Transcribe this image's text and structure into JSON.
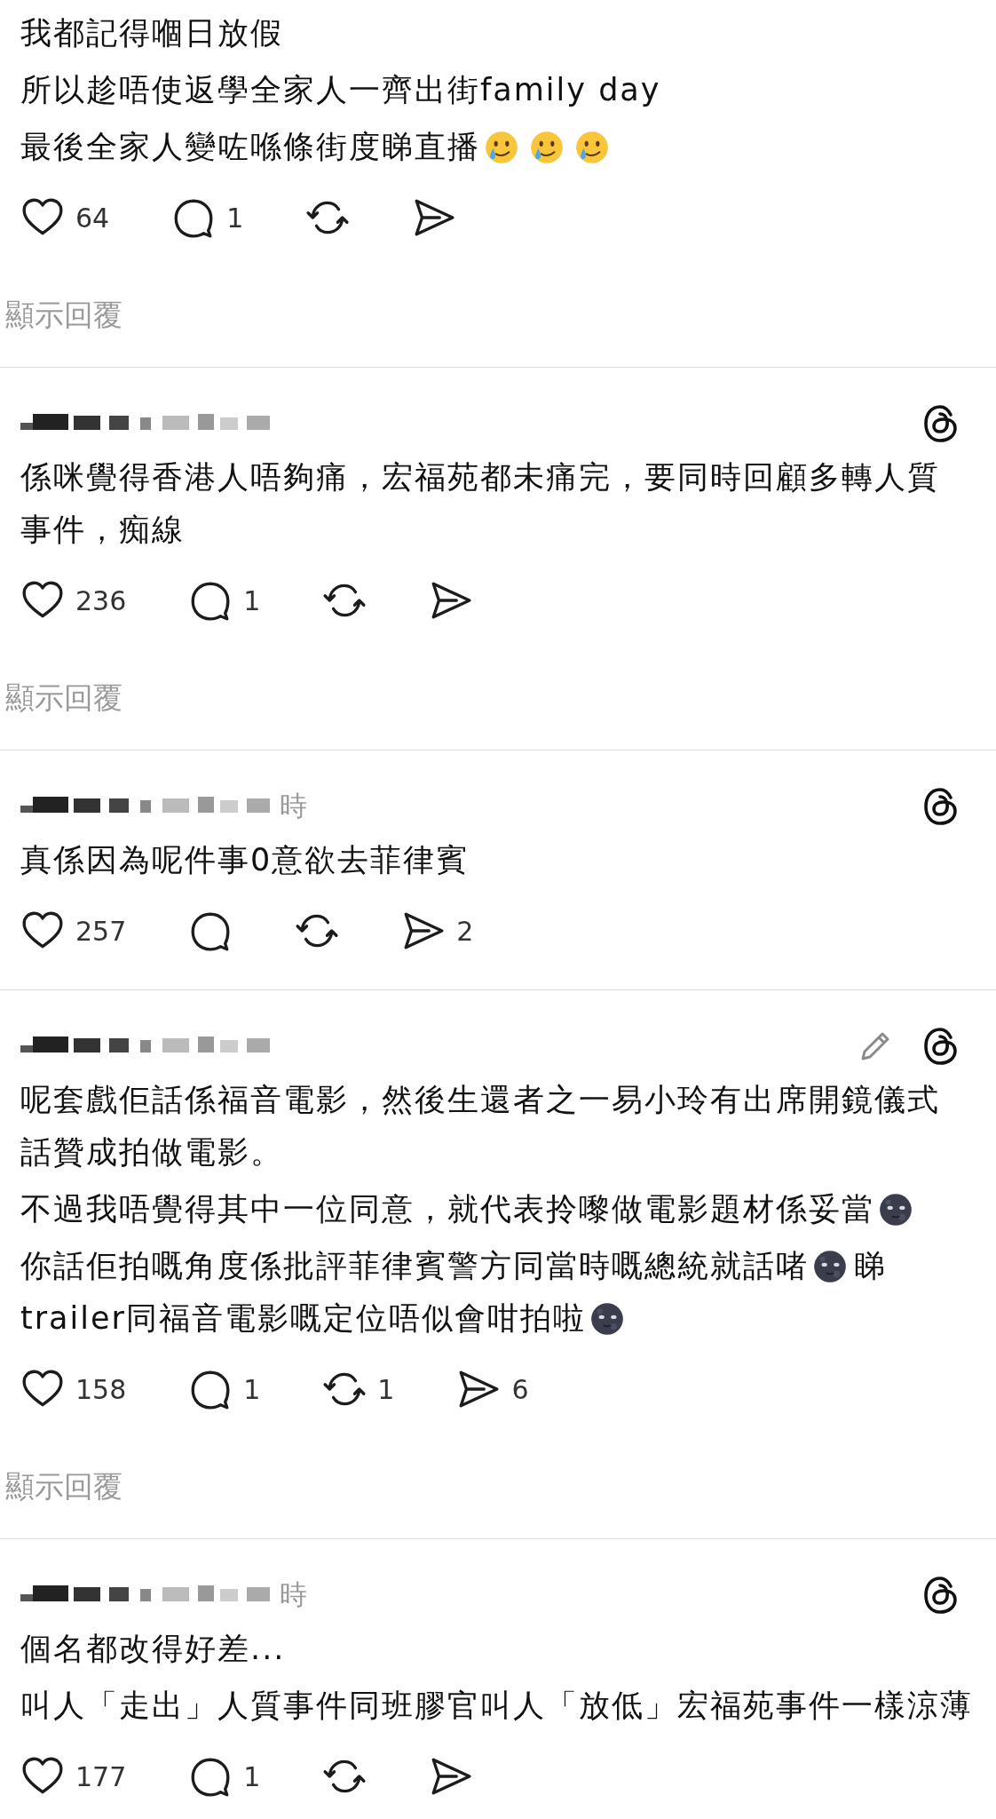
{
  "posts": [
    {
      "paragraphs": [
        [
          [
            {
              "kind": "text",
              "text": "我都記得嗰日放假"
            }
          ]
        ],
        [
          [
            {
              "kind": "text",
              "text": "所以趁唔使返學全家人一齊出街family day"
            }
          ]
        ],
        [
          [
            {
              "kind": "text",
              "text": "最後全家人變咗喺條街度睇直播"
            },
            {
              "kind": "teary-smile"
            },
            {
              "kind": "teary-smile"
            },
            {
              "kind": "teary-smile"
            }
          ]
        ]
      ],
      "actions": {
        "likes": "64",
        "comments": "1"
      },
      "show_replies": "顯示回覆"
    },
    {
      "author": {
        "pixelated": true
      },
      "threads_logo": true,
      "paragraphs": [
        [
          [
            {
              "kind": "text",
              "text": "係咪覺得香港人唔夠痛，宏福苑都未痛完，要同時回顧多轉人質"
            }
          ],
          [
            {
              "kind": "text",
              "text": "事件，痴線"
            }
          ]
        ]
      ],
      "actions": {
        "likes": "236",
        "comments": "1"
      },
      "show_replies": "顯示回覆"
    },
    {
      "author": {
        "pixelated": true,
        "time": "時"
      },
      "threads_logo": true,
      "paragraphs": [
        [
          [
            {
              "kind": "text",
              "text": "真係因為呢件事0意欲去菲律賓"
            }
          ]
        ]
      ],
      "actions": {
        "likes": "257",
        "shares": "2"
      }
    },
    {
      "author": {
        "pixelated": true
      },
      "edit_icon": true,
      "threads_logo": true,
      "paragraphs": [
        [
          [
            {
              "kind": "text",
              "text": "呢套戲佢話係福音電影，然後生還者之一易小玲有出席開鏡儀式"
            }
          ],
          [
            {
              "kind": "text",
              "text": "話贊成拍做電影。"
            }
          ]
        ],
        [
          [
            {
              "kind": "text",
              "text": "不過我唔覺得其中一位同意，就代表拎嚟做電影題材係妥當"
            },
            {
              "kind": "moon-face"
            }
          ]
        ],
        [
          [
            {
              "kind": "text",
              "text": "你話佢拍嘅角度係批評菲律賓警方同當時嘅總統就話啫"
            },
            {
              "kind": "moon-face"
            },
            {
              "kind": "text",
              "text": "睇"
            }
          ],
          [
            {
              "kind": "text",
              "text": "trailer同福音電影嘅定位唔似會咁拍啦"
            },
            {
              "kind": "moon-face"
            }
          ]
        ]
      ],
      "actions": {
        "likes": "158",
        "comments": "1",
        "reposts": "1",
        "shares": "6"
      },
      "show_replies": "顯示回覆"
    },
    {
      "author": {
        "pixelated": true,
        "time": "時"
      },
      "threads_logo": true,
      "paragraphs": [
        [
          [
            {
              "kind": "text",
              "text": "個名都改得好差..."
            }
          ]
        ],
        [
          [
            {
              "kind": "text",
              "text": "叫人「走出」人質事件同班膠官叫人「放低」宏福苑事件一樣涼薄"
            }
          ]
        ]
      ],
      "actions": {
        "likes": "177",
        "comments": "1"
      }
    }
  ]
}
